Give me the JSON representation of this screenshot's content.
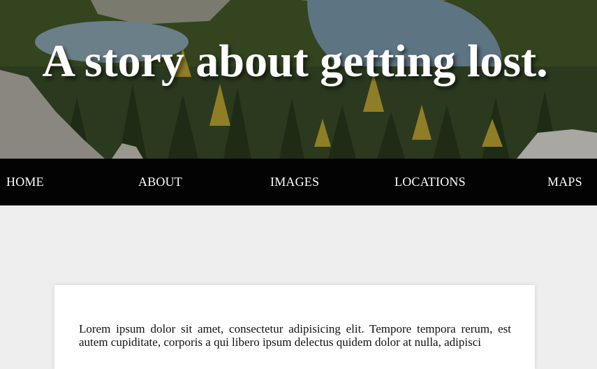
{
  "hero": {
    "title": "A story about getting lost.",
    "image": "mountain-lakes-forest-landscape"
  },
  "nav": {
    "items": [
      {
        "label": "HOME"
      },
      {
        "label": "ABOUT"
      },
      {
        "label": "IMAGES"
      },
      {
        "label": "LOCATIONS"
      },
      {
        "label": "MAPS"
      }
    ]
  },
  "article": {
    "body": "Lorem ipsum dolor sit amet, consectetur adipisicing elit. Tempore tempora rerum, est autem cupiditate, corporis a qui libero ipsum delectus quidem dolor at nulla, adipisci"
  },
  "colors": {
    "nav_background": "#030303",
    "page_background": "#eeeeee",
    "card_background": "#ffffff",
    "title_text": "#ffffff"
  }
}
